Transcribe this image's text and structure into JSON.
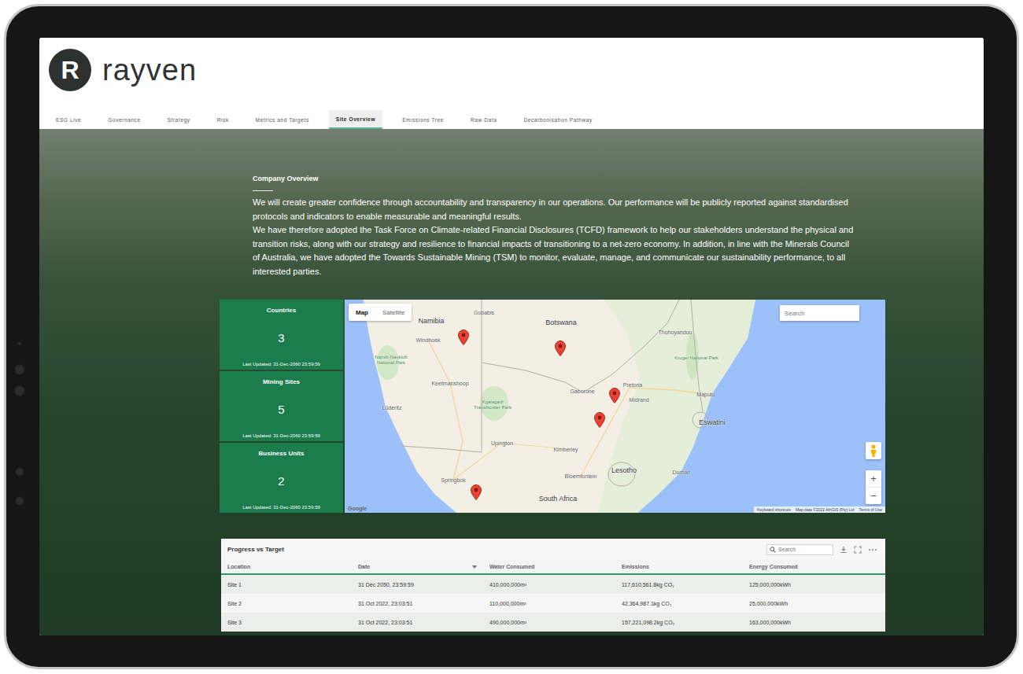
{
  "logo": {
    "mark": "R",
    "name": "rayven"
  },
  "tabs": [
    {
      "label": "ESG Live",
      "selected": false
    },
    {
      "label": "Governance",
      "selected": false
    },
    {
      "label": "Strategy",
      "selected": false
    },
    {
      "label": "Risk",
      "selected": false
    },
    {
      "label": "Metrics and Targets",
      "selected": false
    },
    {
      "label": "Site Overview",
      "selected": true
    },
    {
      "label": "Emissions Tree",
      "selected": false
    },
    {
      "label": "Raw Data",
      "selected": false
    },
    {
      "label": "Decarbonisation Pathway",
      "selected": false
    }
  ],
  "overview": {
    "title": "Company Overview",
    "paragraphs": [
      "We will create greater confidence through accountability and transparency in our operations. Our performance will be publicly reported against standardised protocols and indicators to enable measurable and meaningful results.",
      "We have therefore adopted the Task Force on Climate-related Financial Disclosures (TCFD) framework to help our stakeholders understand the physical and transition risks, along with our strategy and resilience to financial impacts of transitioning to a net-zero economy. In addition, in line with the Minerals Council of Australia, we have adopted the Towards Sustainable Mining (TSM) to monitor, evaluate, manage, and communicate our sustainability performance, to all interested parties."
    ]
  },
  "stats": [
    {
      "label": "Countries",
      "value": "3",
      "updated": "Last Updated: 31-Dec-2060 23:59:59"
    },
    {
      "label": "Mining Sites",
      "value": "5",
      "updated": "Last Updated: 31-Dec-2060 23:59:59"
    },
    {
      "label": "Business Units",
      "value": "2",
      "updated": "Last Updated: 31-Dec-2060 23:59:59"
    }
  ],
  "map": {
    "types": [
      {
        "label": "Map",
        "selected": true
      },
      {
        "label": "Satellite",
        "selected": false
      }
    ],
    "search": {
      "placeholder": "Search"
    },
    "labels": [
      {
        "text": "Namibia",
        "kind": "country"
      },
      {
        "text": "Botswana",
        "kind": "country"
      },
      {
        "text": "Windhoek",
        "kind": "city"
      },
      {
        "text": "Gobabis",
        "kind": "city"
      },
      {
        "text": "Namib-Naukluft National Park",
        "kind": "park"
      },
      {
        "text": "Keetmanshoop",
        "kind": "city"
      },
      {
        "text": "Lüderitz",
        "kind": "city"
      },
      {
        "text": "Kgalagadi Transfrontier Park",
        "kind": "park"
      },
      {
        "text": "Gaborone",
        "kind": "city"
      },
      {
        "text": "Pretoria",
        "kind": "city"
      },
      {
        "text": "Midrand",
        "kind": "city"
      },
      {
        "text": "Maputo",
        "kind": "city"
      },
      {
        "text": "Eswatini",
        "kind": "country"
      },
      {
        "text": "Kruger National Park",
        "kind": "park"
      },
      {
        "text": "Thohoyandou",
        "kind": "city"
      },
      {
        "text": "Upington",
        "kind": "city"
      },
      {
        "text": "Kimberley",
        "kind": "city"
      },
      {
        "text": "Bloemfontein",
        "kind": "city"
      },
      {
        "text": "Lesotho",
        "kind": "country"
      },
      {
        "text": "Durban",
        "kind": "city"
      },
      {
        "text": "Springbok",
        "kind": "city"
      },
      {
        "text": "South Africa",
        "kind": "country"
      }
    ],
    "pin_count": 5,
    "zoom": [
      "+",
      "−"
    ],
    "brand": "Google",
    "footer": [
      "Keyboard shortcuts",
      "Map data ©2022 AfriGIS (Pty) Ltd",
      "Terms of Use"
    ]
  },
  "table": {
    "title": "Progress vs Target",
    "search": {
      "placeholder": "Search"
    },
    "columns": [
      {
        "label": "Location",
        "sorted": false
      },
      {
        "label": "Date",
        "sorted": true
      },
      {
        "label": "Water Consumed",
        "sorted": false
      },
      {
        "label": "Emissions",
        "sorted": false
      },
      {
        "label": "Energy Consumed",
        "sorted": false
      }
    ],
    "rows": [
      [
        "Site 1",
        "31 Dec 2050, 23:59:59",
        "410,000,000m³",
        "117,610,561.8kg CO₂",
        "125,000,000kWh"
      ],
      [
        "Site 2",
        "31 Oct 2022, 23:03:51",
        "110,000,000m³",
        "42,364,987.1kg CO₂",
        "25,000,000kWh"
      ],
      [
        "Site 3",
        "31 Oct 2022, 23:03:51",
        "490,000,000m³",
        "157,221,098.2kg CO₂",
        "163,000,000kWh"
      ]
    ]
  }
}
